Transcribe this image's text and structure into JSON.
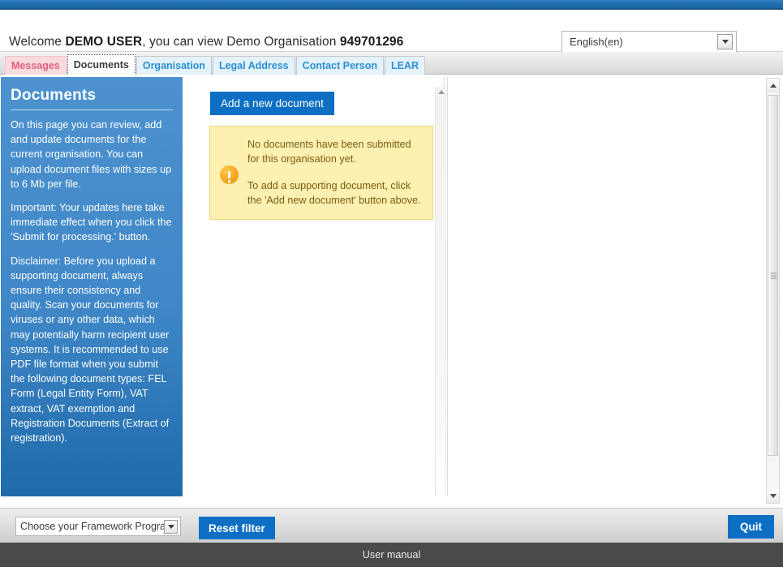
{
  "header": {
    "welcome_prefix": "Welcome ",
    "user_name": "DEMO USER",
    "welcome_middle": ", you can view Demo Organisation ",
    "organisation_id": "949701296",
    "language_value": "English(en)"
  },
  "tabs": [
    {
      "label": "Messages"
    },
    {
      "label": "Documents"
    },
    {
      "label": "Organisation"
    },
    {
      "label": "Legal Address"
    },
    {
      "label": "Contact Person"
    },
    {
      "label": "LEAR"
    }
  ],
  "sidebar": {
    "title": "Documents",
    "paragraphs": [
      "On this page you can review, add and update documents for the current organisation. You can upload document files with sizes up to 6 Mb per file.",
      "Important: Your updates here take immediate effect when you click the 'Submit for processing.' button.",
      "Disclaimer: Before you upload a supporting document, always ensure their consistency and quality. Scan your documents for viruses or any other data, which may potentially harm recipient user systems. It is recommended to use PDF file format when you submit the following document types: FEL Form (Legal Entity Form), VAT extract, VAT exemption and Registration Documents (Extract of registration)."
    ]
  },
  "main": {
    "add_document_label": "Add a new document",
    "notice": {
      "line1": "No documents have been submitted for this organisation yet.",
      "line2": "To add a supporting document, click the 'Add new document' button above."
    }
  },
  "toolbar": {
    "framework_programme_value": "Choose your Framework Programme",
    "reset_filter_label": "Reset filter",
    "quit_label": "Quit"
  },
  "footer": {
    "user_manual_label": "User manual"
  },
  "colors": {
    "accent_blue": "#0d6fc4",
    "sidebar_blue": "#3f87c7",
    "notice_yellow": "#fdf0b0",
    "warning_orange": "#f5a623",
    "tab_active_text": "#3c3c3c",
    "tab_link_blue": "#2b8fd4",
    "tab_messages_pink": "#fadadd",
    "footer_dark": "#4a4a4a"
  }
}
